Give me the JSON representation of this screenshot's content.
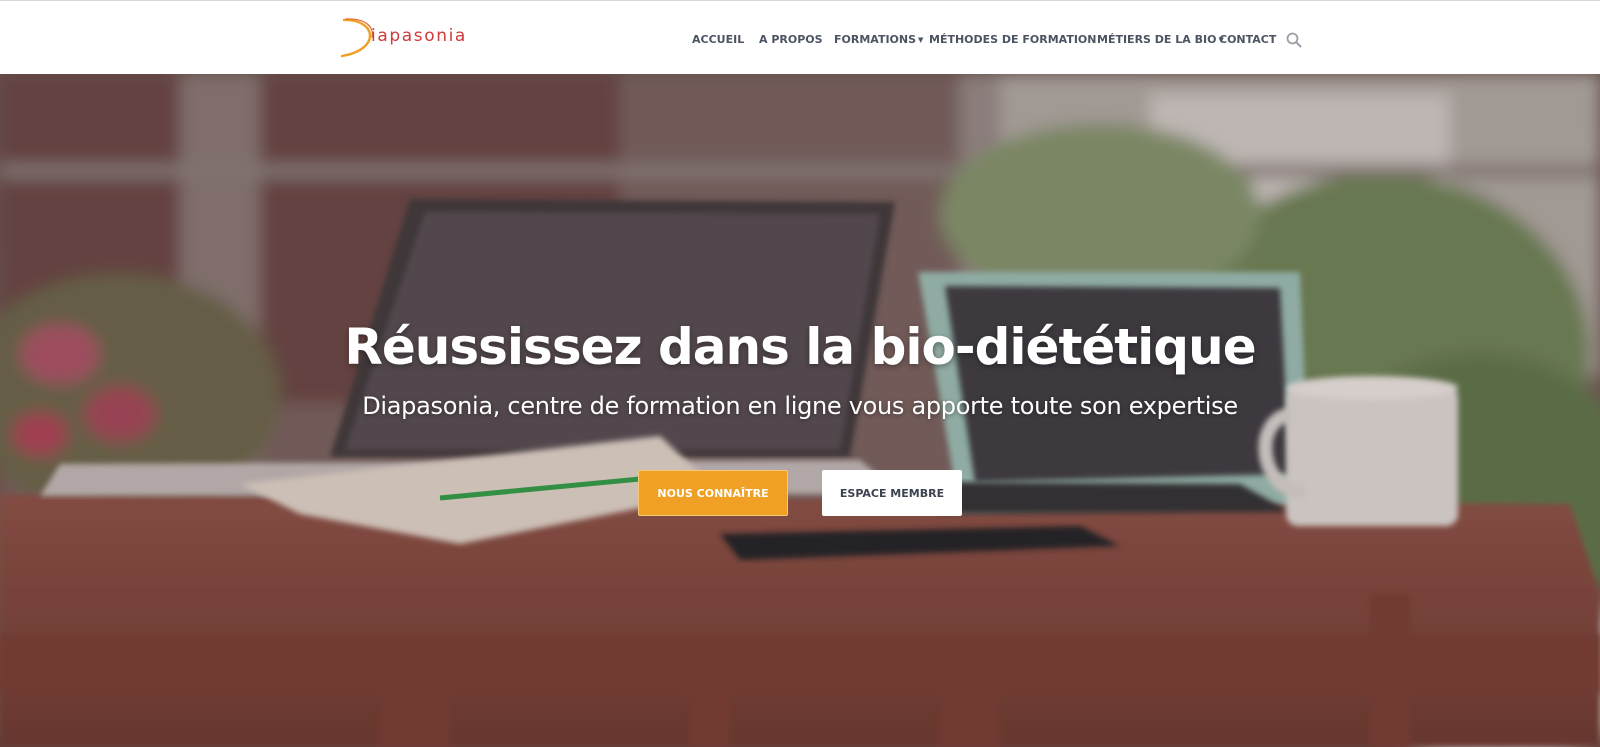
{
  "header": {
    "logo_text": "iapasonia",
    "nav": [
      {
        "label": "ACCUEIL",
        "dropdown": false
      },
      {
        "label": "A PROPOS",
        "dropdown": false
      },
      {
        "label": "FORMATIONS",
        "dropdown": true
      },
      {
        "label": "MÉTHODES DE FORMATION",
        "dropdown": false
      },
      {
        "label": "MÉTIERS DE LA BIO",
        "dropdown": true
      },
      {
        "label": "CONTACT",
        "dropdown": false
      }
    ],
    "search_icon": "search-icon"
  },
  "hero": {
    "title": "Réussissez dans la bio-diététique",
    "subtitle": "Diapasonia, centre de formation en ligne vous apporte toute son expertise",
    "primary_button": "NOUS CONNAÎTRE",
    "secondary_button": "ESPACE MEMBRE"
  },
  "colors": {
    "accent": "#f0a024",
    "logo": "#cf3a3a",
    "nav_text": "#4c5463"
  }
}
